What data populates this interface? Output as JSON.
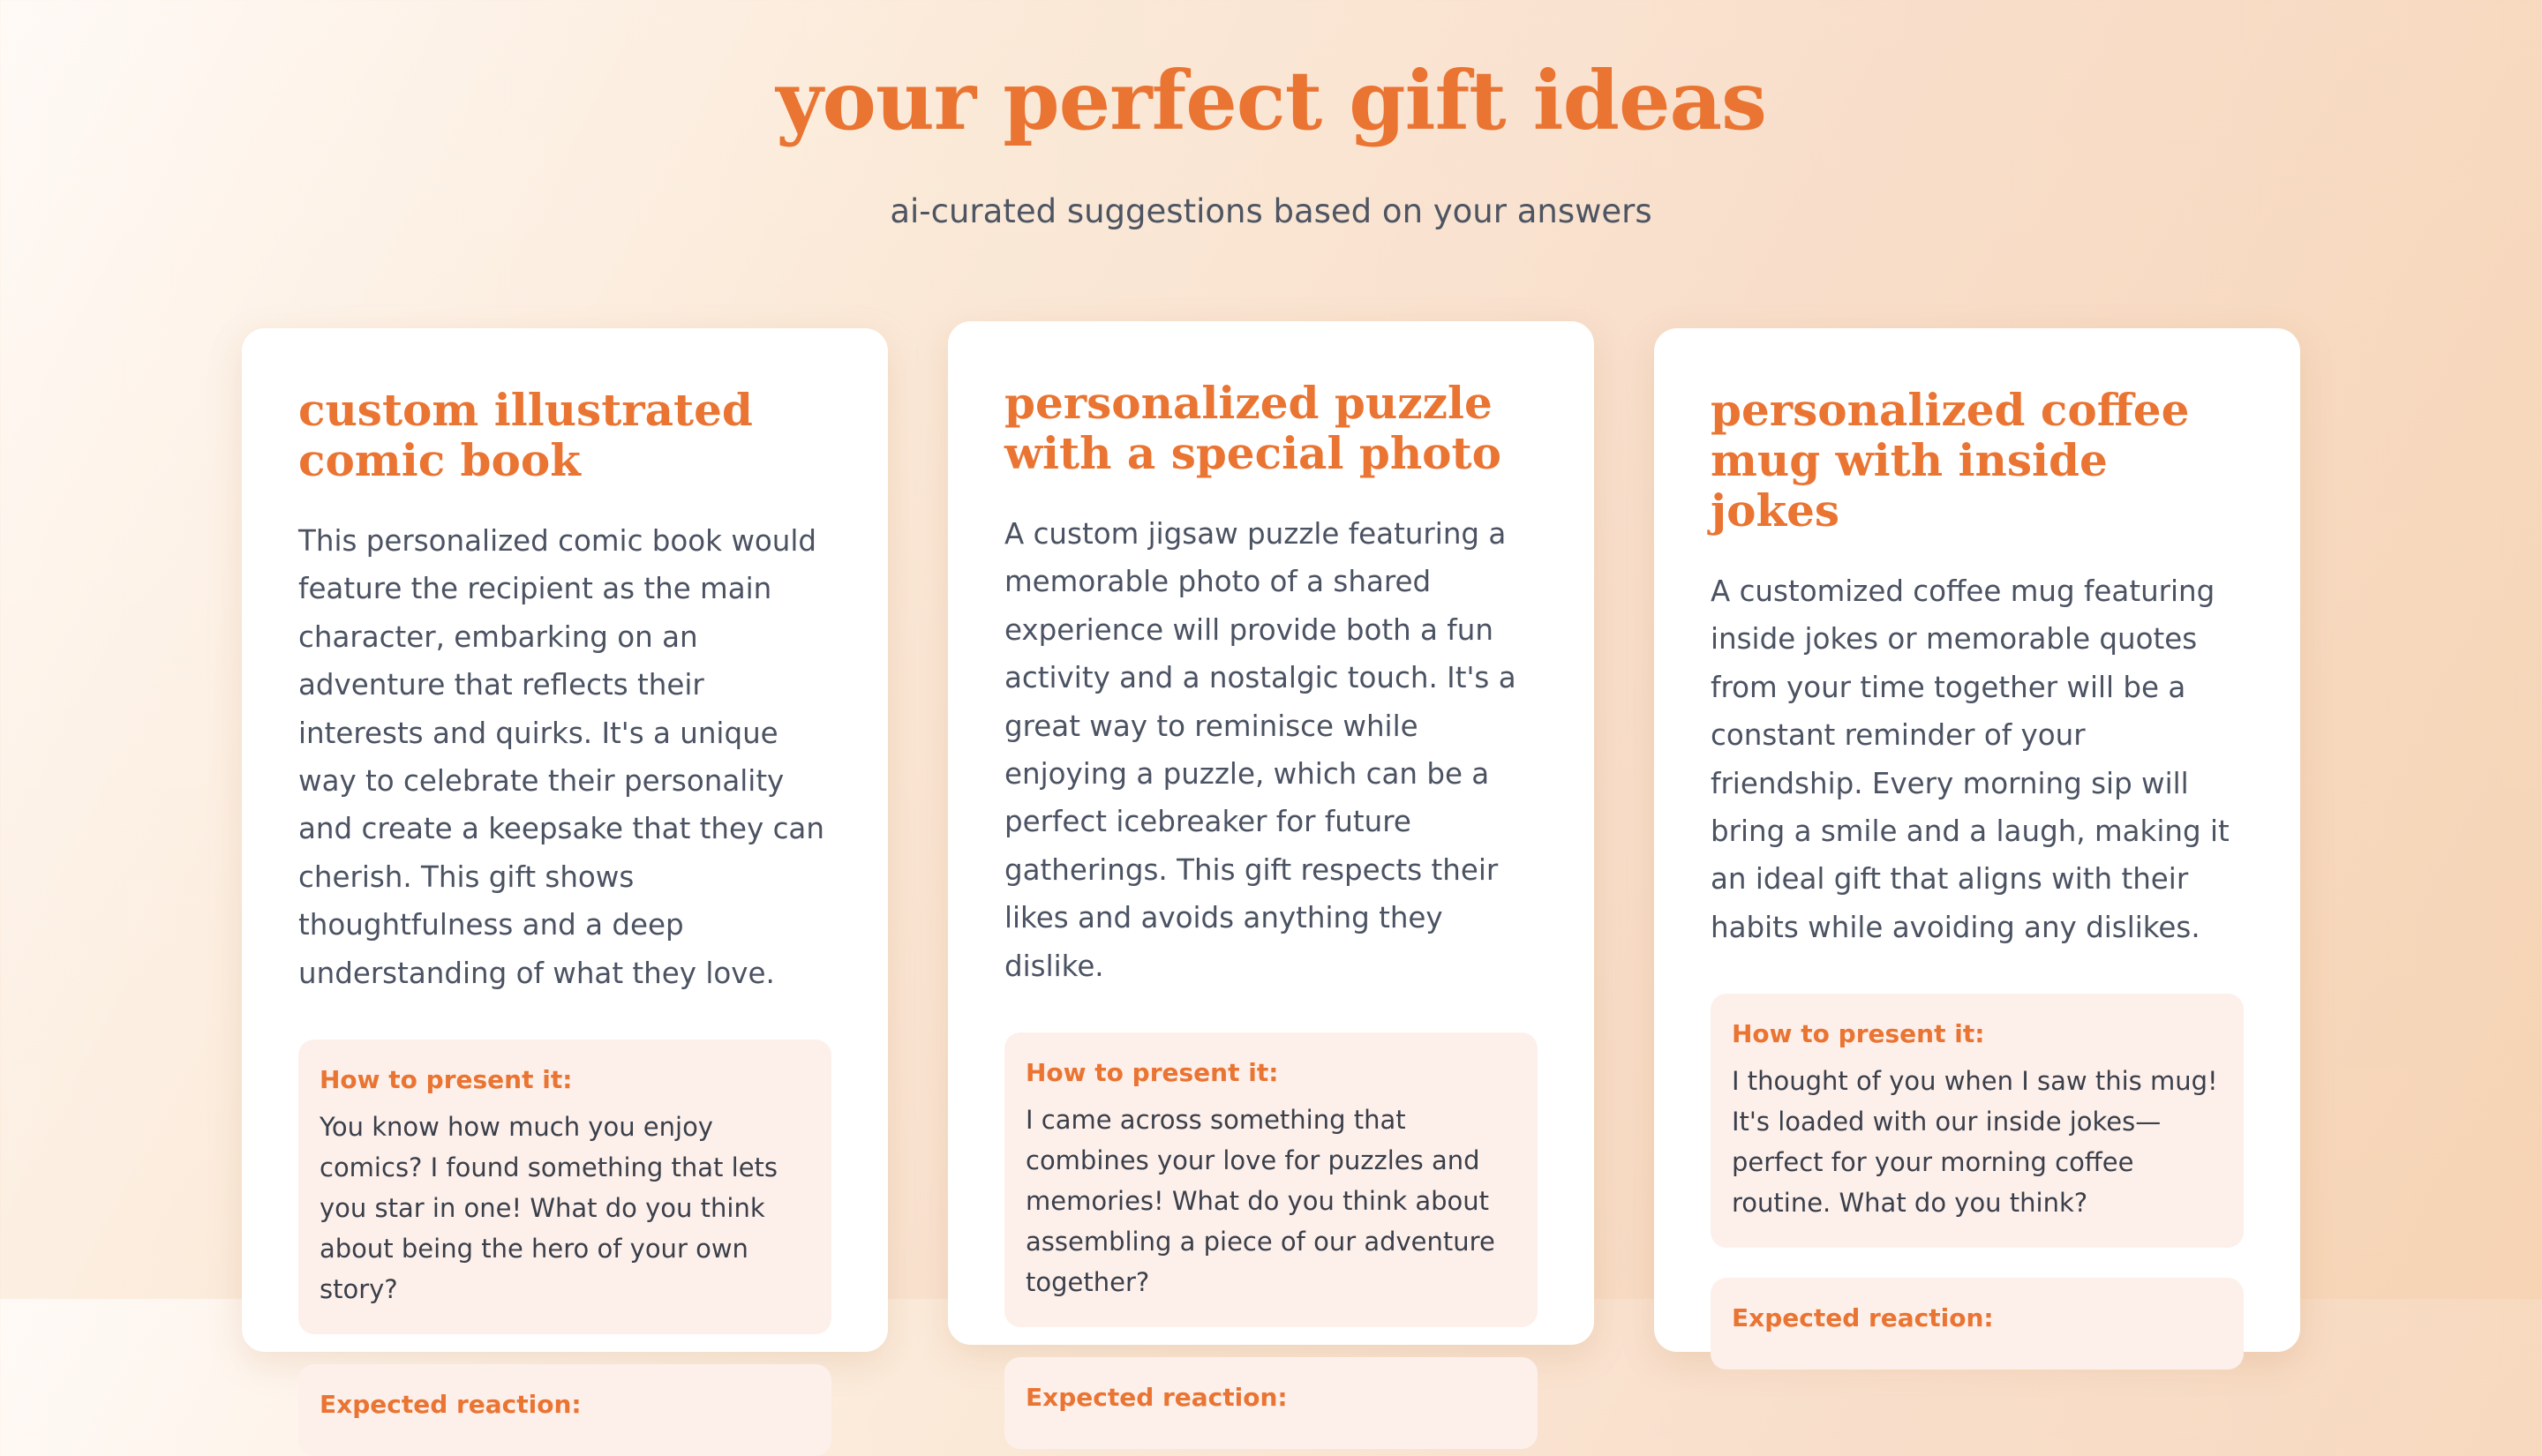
{
  "header": {
    "title": "your perfect gift ideas",
    "subtitle": "ai-curated suggestions based on your answers"
  },
  "cards": [
    {
      "title": "custom illustrated comic book",
      "description": "This personalized comic book would feature the recipient as the main character, embarking on an adventure that reflects their interests and quirks. It's a unique way to celebrate their personality and create a keepsake that they can cherish. This gift shows thoughtfulness and a deep understanding of what they love.",
      "present_label": "How to present it:",
      "present_text": "You know how much you enjoy comics? I found something that lets you star in one! What do you think about being the hero of your own story?",
      "reaction_label": "Expected reaction:"
    },
    {
      "title": "personalized puzzle with a special photo",
      "description": "A custom jigsaw puzzle featuring a memorable photo of a shared experience will provide both a fun activity and a nostalgic touch. It's a great way to reminisce while enjoying a puzzle, which can be a perfect icebreaker for future gatherings. This gift respects their likes and avoids anything they dislike.",
      "present_label": "How to present it:",
      "present_text": "I came across something that combines your love for puzzles and memories! What do you think about assembling a piece of our adventure together?",
      "reaction_label": "Expected reaction:"
    },
    {
      "title": "personalized coffee mug with inside jokes",
      "description": "A customized coffee mug featuring inside jokes or memorable quotes from your time together will be a constant reminder of your friendship. Every morning sip will bring a smile and a laugh, making it an ideal gift that aligns with their habits while avoiding any dislikes.",
      "present_label": "How to present it:",
      "present_text": "I thought of you when I saw this mug! It's loaded with our inside jokes—perfect for your morning coffee routine. What do you think?",
      "reaction_label": "Expected reaction:"
    }
  ]
}
